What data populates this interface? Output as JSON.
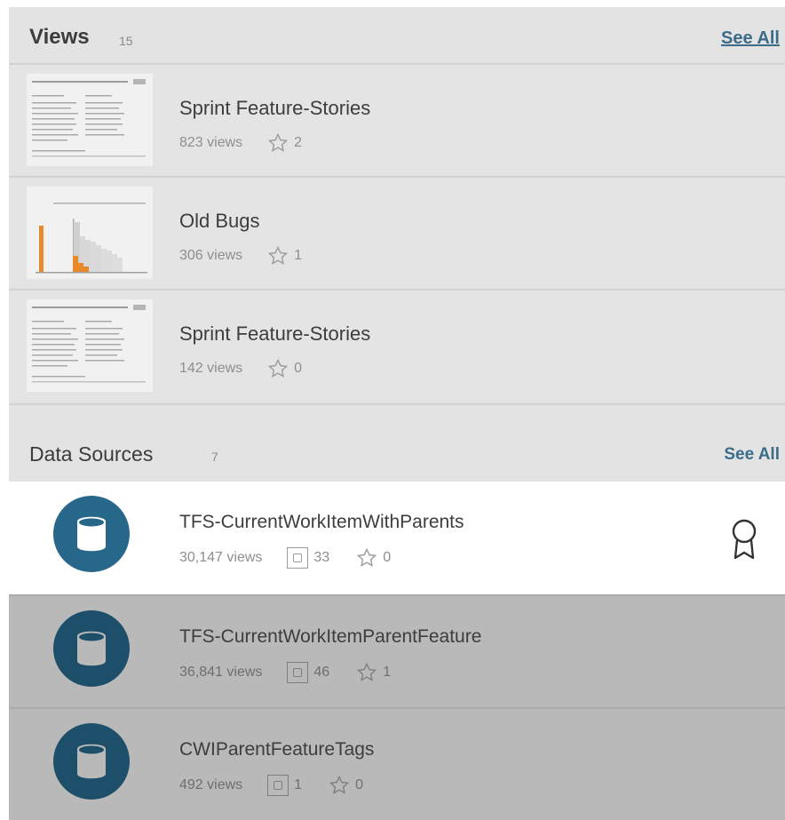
{
  "views_section": {
    "title": "Views",
    "count": "15",
    "see_all": "See All",
    "items": [
      {
        "title": "Sprint Feature-Stories",
        "views": "823 views",
        "stars": "2",
        "thumb": "table-thumbnail"
      },
      {
        "title": "Old Bugs",
        "views": "306 views",
        "stars": "1",
        "thumb": "bar-chart-thumbnail"
      },
      {
        "title": "Sprint Feature-Stories",
        "views": "142 views",
        "stars": "0",
        "thumb": "table-thumbnail"
      }
    ]
  },
  "data_sources_section": {
    "title": "Data Sources",
    "count": "7",
    "see_all": "See All",
    "items": [
      {
        "title": "TFS-CurrentWorkItemWithParents",
        "views": "30,147 views",
        "connections": "33",
        "stars": "0",
        "certified": true,
        "selected": true
      },
      {
        "title": "TFS-CurrentWorkItemParentFeature",
        "views": "36,841 views",
        "connections": "46",
        "stars": "1",
        "certified": false,
        "selected": false
      },
      {
        "title": "CWIParentFeatureTags",
        "views": "492 views",
        "connections": "1",
        "stars": "0",
        "certified": false,
        "selected": false
      }
    ]
  },
  "colors": {
    "db_icon": "#27678a",
    "db_icon_dim": "#1e4f6a",
    "link": "#3b6c8a",
    "thumb_orange": "#e8892b"
  },
  "icons": {
    "star": "star-icon",
    "database": "database-icon",
    "certified": "certified-badge-icon",
    "connections": "connections-icon"
  }
}
